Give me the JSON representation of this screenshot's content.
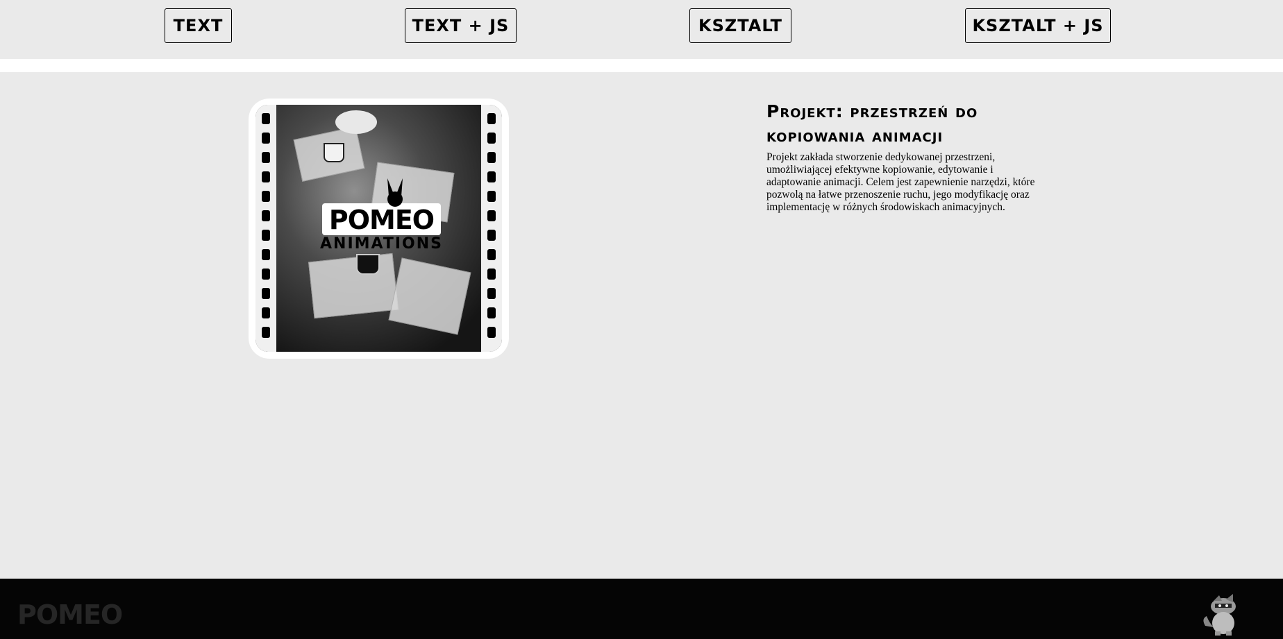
{
  "nav": {
    "items": [
      {
        "label": "TEXT"
      },
      {
        "label": "TEXT + JS"
      },
      {
        "label": "KSZTALT"
      },
      {
        "label": "KSZTALT + JS"
      }
    ]
  },
  "hero": {
    "logo_main": "POMEO",
    "logo_sub": "ANIMATIONS"
  },
  "project": {
    "title": "Projekt: przestrzeń do kopiowania animacji",
    "description": "Projekt zakłada stworzenie dedykowanej przestrzeni, umożliwiającej efektywne kopiowanie, edytowanie i adaptowanie animacji. Celem jest zapewnienie narzędzi, które pozwolą na łatwe przenoszenie ruchu, jego modyfikację oraz implementację w różnych środowiskach animacyjnych."
  },
  "footer": {
    "logo": "POMEO",
    "mascot_icon": "raccoon-mascot-icon"
  },
  "colors": {
    "background": "#eaeaea",
    "footer": "#050505",
    "footer_logo": "#262626"
  }
}
